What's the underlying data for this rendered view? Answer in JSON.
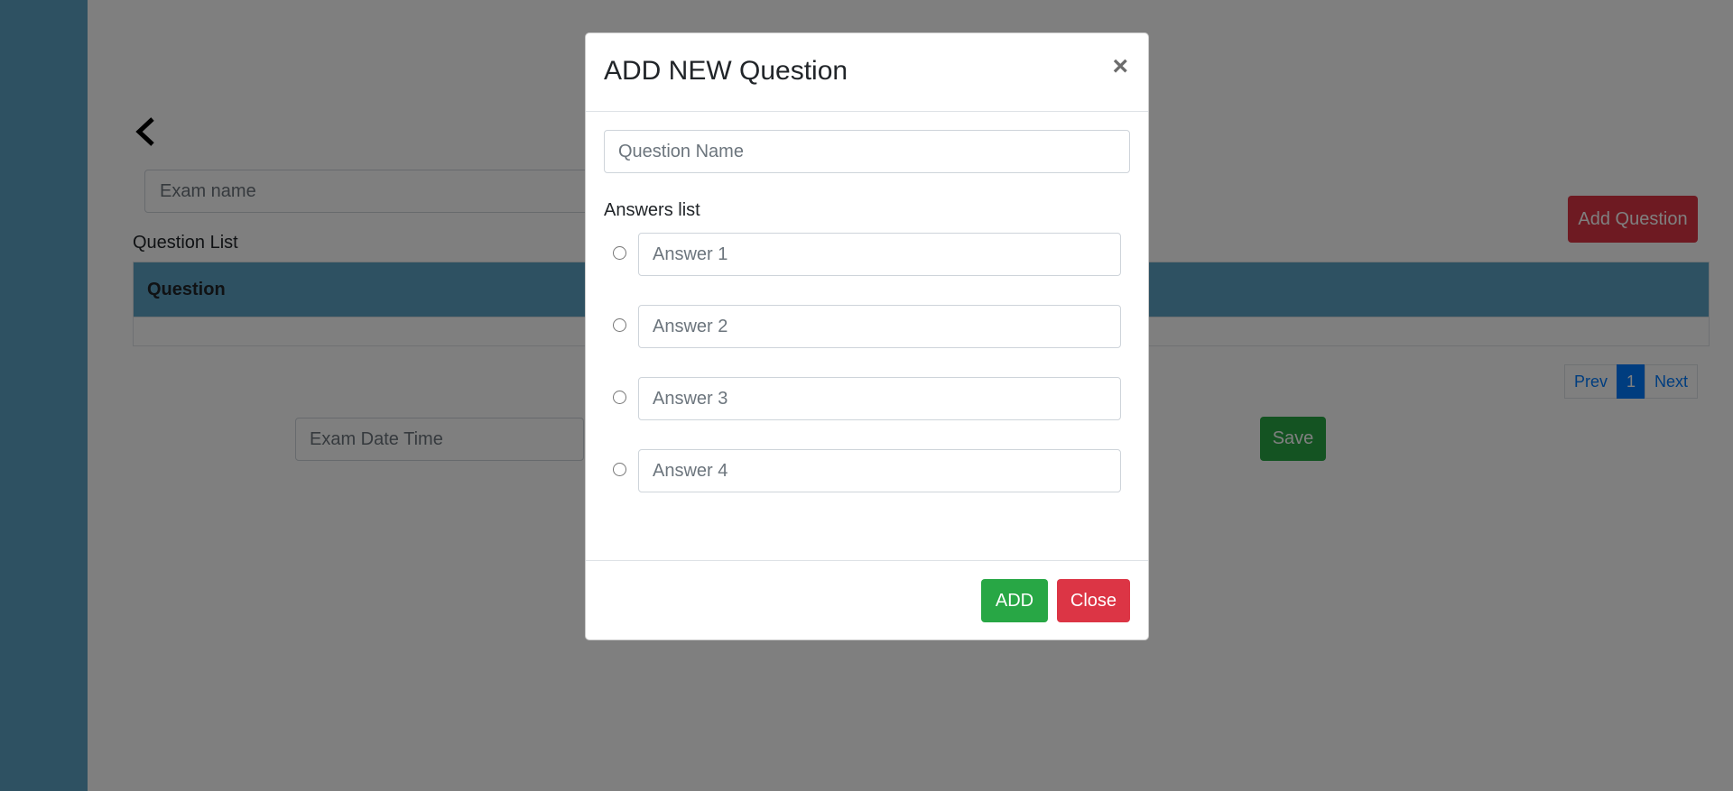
{
  "page": {
    "back_icon": "chevron-left-icon",
    "exam_name_placeholder": "Exam name",
    "add_question_label": "Add Question",
    "question_list_label": "Question List",
    "table": {
      "columns": [
        "Question"
      ],
      "rows": []
    },
    "pagination": {
      "prev": "Prev",
      "current": "1",
      "next": "Next"
    },
    "exam_datetime_placeholder": "Exam Date Time",
    "save_label": "Save"
  },
  "modal": {
    "title": "ADD NEW Question",
    "close_symbol": "×",
    "question_name_placeholder": "Question Name",
    "answers_label": "Answers list",
    "answers": [
      {
        "placeholder": "Answer 1",
        "selected": false
      },
      {
        "placeholder": "Answer 2",
        "selected": false
      },
      {
        "placeholder": "Answer 3",
        "selected": false
      },
      {
        "placeholder": "Answer 4",
        "selected": false
      }
    ],
    "add_label": "ADD",
    "close_label": "Close"
  },
  "colors": {
    "sidebar": "#5da2c4",
    "primary": "#007bff",
    "success": "#28a745",
    "danger": "#dc3545"
  }
}
